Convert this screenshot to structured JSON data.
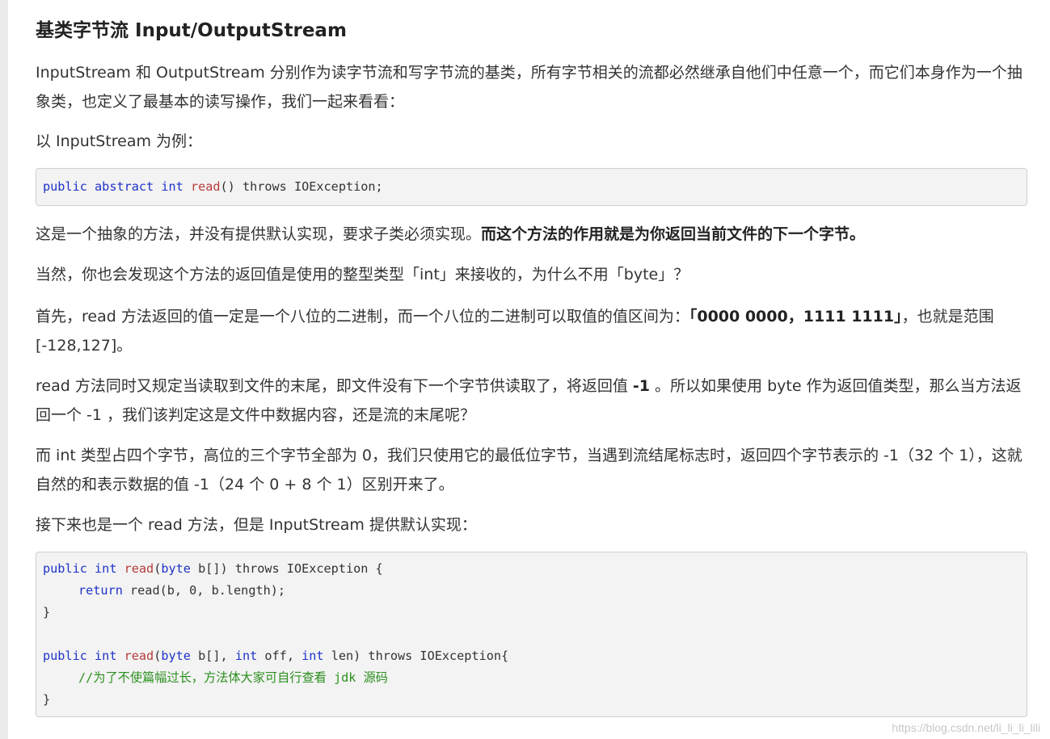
{
  "heading": "基类字节流 Input/OutputStream",
  "paragraphs": {
    "intro": "InputStream 和 OutputStream 分别作为读字节流和写字节流的基类，所有字节相关的流都必然继承自他们中任意一个，而它们本身作为一个抽象类，也定义了最基本的读写操作，我们一起来看看：",
    "example_lead": "以 InputStream 为例：",
    "abstract_note_plain": "这是一个抽象的方法，并没有提供默认实现，要求子类必须实现。",
    "abstract_note_bold": "而这个方法的作用就是为你返回当前文件的下一个字节。",
    "return_type_question": "当然，你也会发现这个方法的返回值是使用的整型类型「int」来接收的，为什么不用「byte」？",
    "first_plain_a": "首先，read 方法返回的值一定是一个八位的二进制，而一个八位的二进制可以取值的值区间为：",
    "first_bold": "「0000 0000，1111 1111」",
    "first_plain_b": "，也就是范围 [-128,127]。",
    "eof_plain_a": "read 方法同时又规定当读取到文件的末尾，即文件没有下一个字节供读取了，将返回值 ",
    "eof_bold": "-1",
    "eof_plain_b": " 。所以如果使用 byte 作为返回值类型，那么当方法返回一个 -1 ，我们该判定这是文件中数据内容，还是流的末尾呢？",
    "int_explain": "而 int 类型占四个字节，高位的三个字节全部为 0，我们只使用它的最低位字节，当遇到流结尾标志时，返回四个字节表示的 -1（32 个 1），这就自然的和表示数据的值 -1（24 个 0 + 8 个 1）区别开来了。",
    "next_read": "接下来也是一个 read 方法，但是 InputStream 提供默认实现："
  },
  "code1": {
    "kw_public": "public",
    "kw_abstract": "abstract",
    "ty_int": "int",
    "fn_read": "read",
    "rest": "() throws IOException;"
  },
  "code2": {
    "l1_public": "public",
    "l1_int": "int",
    "l1_read": "read",
    "l1_paren": "(",
    "l1_byte": "byte",
    "l1_rest": " b[]) throws IOException {",
    "l2_return": "return",
    "l2_rest": " read(b, 0, b.length);",
    "l3": "}",
    "l5_public": "public",
    "l5_int": "int",
    "l5_read": "read",
    "l5_paren": "(",
    "l5_byte": "byte",
    "l5_b": " b[], ",
    "l5_int2": "int",
    "l5_off": " off, ",
    "l5_int3": "int",
    "l5_rest": " len) throws IOException{",
    "l6_comment": "//为了不使篇幅过长，方法体大家可自行查看 jdk 源码",
    "l7": "}"
  },
  "watermark": "https://blog.csdn.net/li_li_li_lili"
}
